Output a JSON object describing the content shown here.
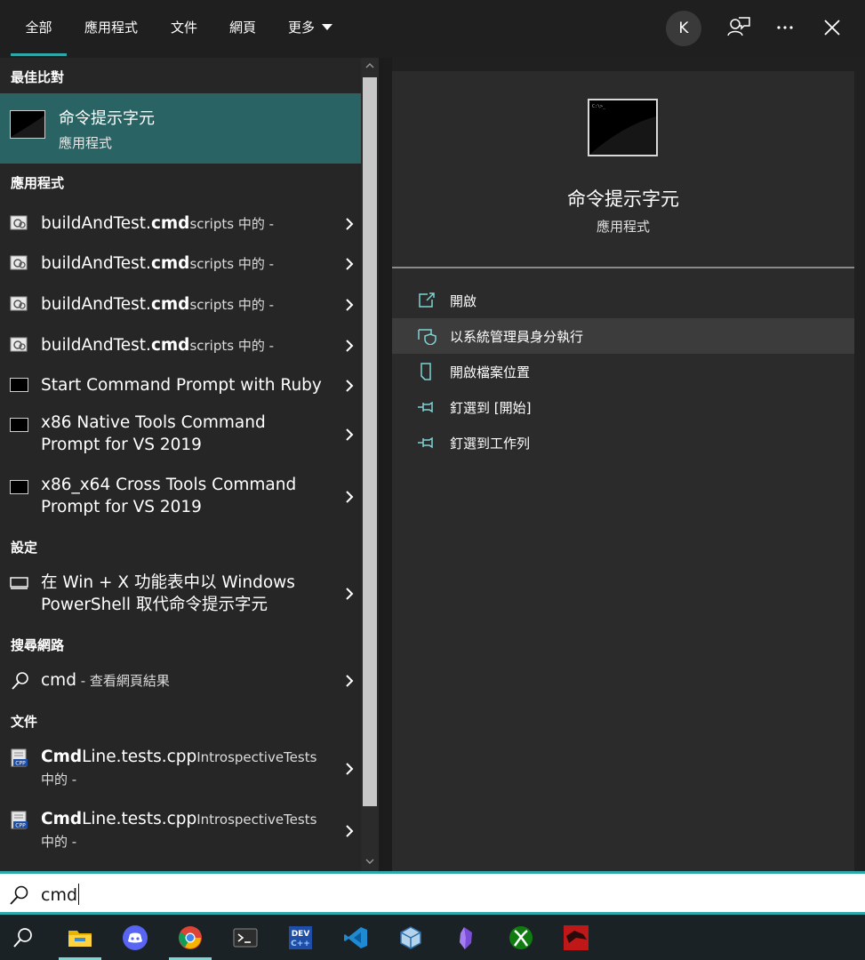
{
  "tabs": [
    {
      "label": "全部"
    },
    {
      "label": "應用程式"
    },
    {
      "label": "文件"
    },
    {
      "label": "網頁"
    },
    {
      "label": "更多"
    }
  ],
  "account": {
    "initial": "K"
  },
  "left": {
    "best_match": {
      "heading": "最佳比對",
      "title": "命令提示字元",
      "subtitle": "應用程式"
    },
    "apps": {
      "heading": "應用程式",
      "items": [
        {
          "name": "buildAndTest.",
          "bold": "cmd",
          "location": "scripts 中的 -"
        },
        {
          "name": "buildAndTest.",
          "bold": "cmd",
          "location": "scripts 中的 -"
        },
        {
          "name": "buildAndTest.",
          "bold": "cmd",
          "location": "scripts 中的 -"
        },
        {
          "name": "buildAndTest.",
          "bold": "cmd",
          "location": "scripts 中的 -"
        },
        {
          "line1": "Start Command Prompt with Ruby"
        },
        {
          "line1": "x86 Native Tools Command",
          "line2": "Prompt for VS 2019"
        },
        {
          "line1": "x86_x64 Cross Tools Command",
          "line2": "Prompt for VS 2019"
        }
      ]
    },
    "settings": {
      "heading": "設定",
      "items": [
        {
          "line1": "在 Win + X 功能表中以 Windows",
          "line2": "PowerShell 取代命令提示字元"
        }
      ]
    },
    "web": {
      "heading": "搜尋網路",
      "items": [
        {
          "query": "cmd",
          "suffix": " - 查看網頁結果"
        }
      ]
    },
    "documents": {
      "heading": "文件",
      "items": [
        {
          "bold": "Cmd",
          "name": "Line.tests.cpp",
          "location": "IntrospectiveTests",
          "line2": "中的 -"
        },
        {
          "bold": "Cmd",
          "name": "Line.tests.cpp",
          "location": "IntrospectiveTests",
          "line2": "中的 -"
        }
      ]
    }
  },
  "preview": {
    "title": "命令提示字元",
    "subtitle": "應用程式",
    "actions": [
      {
        "label": "開啟",
        "icon": "open-icon"
      },
      {
        "label": "以系統管理員身分執行",
        "icon": "shield-icon"
      },
      {
        "label": "開啟檔案位置",
        "icon": "file-location-icon"
      },
      {
        "label": "釘選到 [開始]",
        "icon": "pin-icon"
      },
      {
        "label": "釘選到工作列",
        "icon": "pin-icon"
      }
    ]
  },
  "search": {
    "query": "cmd"
  },
  "taskbar": {
    "items": [
      {
        "name": "search-icon"
      },
      {
        "name": "file-explorer-icon"
      },
      {
        "name": "discord-icon"
      },
      {
        "name": "chrome-icon"
      },
      {
        "name": "terminal-icon"
      },
      {
        "name": "devcpp-icon"
      },
      {
        "name": "vscode-icon"
      },
      {
        "name": "virtualbox-icon"
      },
      {
        "name": "obsidian-icon"
      },
      {
        "name": "xbox-icon"
      },
      {
        "name": "red-app-icon"
      }
    ]
  },
  "colors": {
    "accent": "#2ea8a8",
    "best_match_bg": "#2a6363",
    "panel_bg": "#262626",
    "preview_bg": "#2b2b2b"
  }
}
